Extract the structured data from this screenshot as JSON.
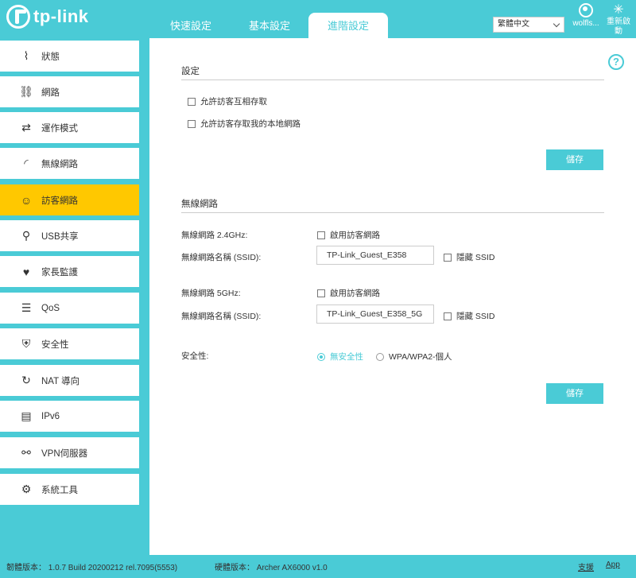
{
  "header": {
    "logo_text": "tp-link",
    "tabs": [
      {
        "label": "快速設定"
      },
      {
        "label": "基本設定"
      },
      {
        "label": "進階設定"
      }
    ],
    "language": "繁體中文",
    "user": "wolfls...",
    "reboot": "重新啟動",
    "accent_color": "#4acbd6",
    "highlight_color": "#ffc800"
  },
  "sidebar": {
    "items": [
      {
        "label": "狀態",
        "icon": "pulse-icon"
      },
      {
        "label": "網路",
        "icon": "network-icon"
      },
      {
        "label": "運作模式",
        "icon": "mode-switch-icon"
      },
      {
        "label": "無線網路",
        "icon": "wireless-icon"
      },
      {
        "label": "訪客網路",
        "icon": "guest-icon"
      },
      {
        "label": "USB共享",
        "icon": "usb-icon"
      },
      {
        "label": "家長監護",
        "icon": "parental-icon"
      },
      {
        "label": "QoS",
        "icon": "qos-icon"
      },
      {
        "label": "安全性",
        "icon": "shield-icon"
      },
      {
        "label": "NAT 導向",
        "icon": "nat-icon"
      },
      {
        "label": "IPv6",
        "icon": "ipv6-icon"
      },
      {
        "label": "VPN伺服器",
        "icon": "vpn-icon"
      },
      {
        "label": "系統工具",
        "icon": "gear-icon"
      }
    ]
  },
  "settings": {
    "title": "設定",
    "opt_allow_access_each_other": "允許訪客互相存取",
    "opt_allow_local_network": "允許訪客存取我的本地網路",
    "save": "儲存"
  },
  "wireless": {
    "title": "無線網路",
    "band24_label": "無線網路 2.4GHz:",
    "band24_enable": "啟用訪客網路",
    "ssid24_label": "無線網路名稱 (SSID):",
    "ssid24_value": "TP-Link_Guest_E358",
    "hide24": "隱藏 SSID",
    "band5_label": "無線網路 5GHz:",
    "band5_enable": "啟用訪客網路",
    "ssid5_label": "無線網路名稱 (SSID):",
    "ssid5_value": "TP-Link_Guest_E358_5G",
    "hide5": "隱藏 SSID",
    "security_label": "安全性:",
    "security_none": "無安全性",
    "security_wpa": "WPA/WPA2-個人",
    "save": "儲存"
  },
  "footer": {
    "firmware": "韌體版本： 1.0.7 Build 20200212 rel.7095(5553)",
    "hardware": "硬體版本： Archer AX6000 v1.0",
    "support": "支援",
    "app": "App"
  }
}
